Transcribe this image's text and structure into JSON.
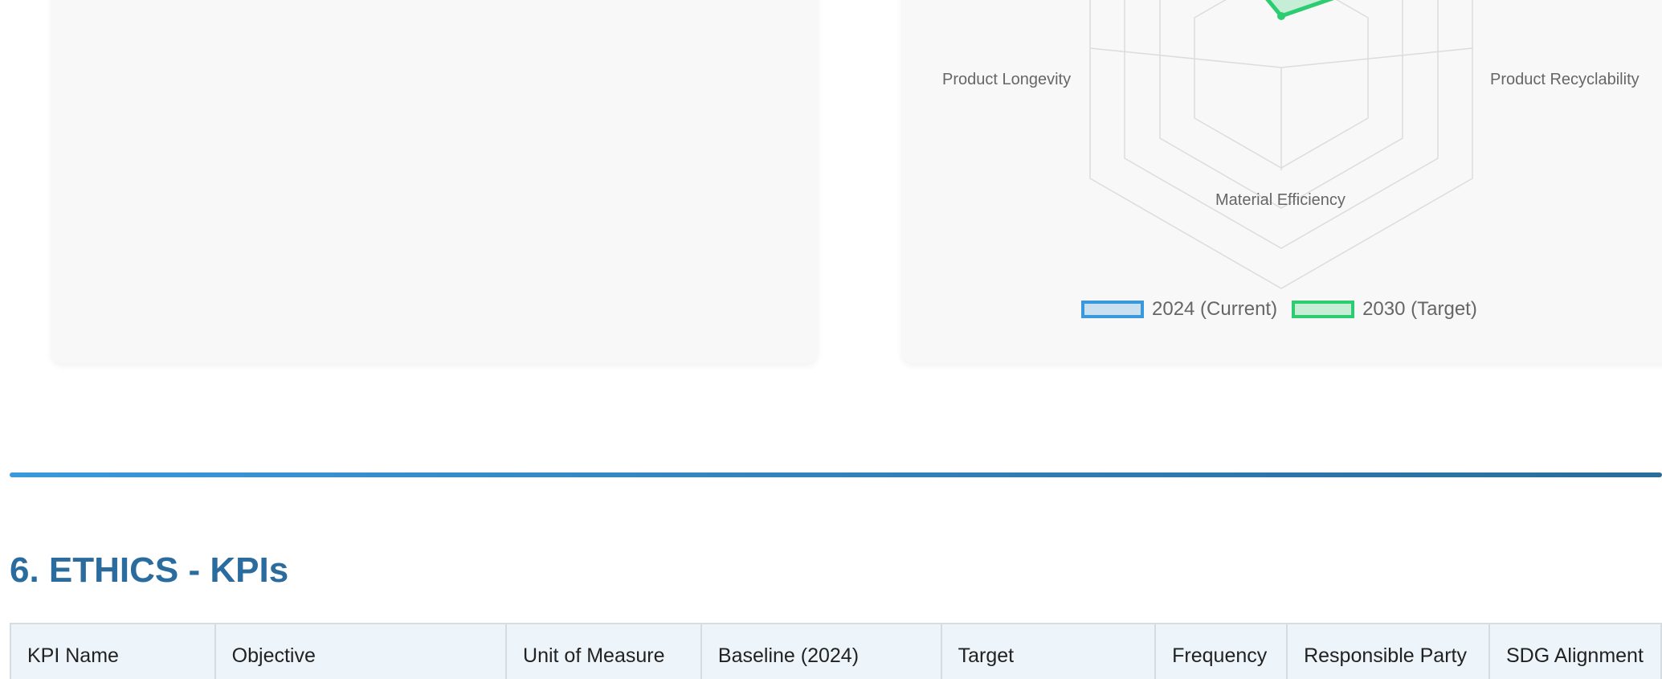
{
  "radar_chart": {
    "axis_labels": {
      "left": "Product Longevity",
      "right": "Product Recyclability",
      "bottom": "Material Efficiency"
    },
    "legend": [
      {
        "label": "2024 (Current)",
        "color": "#3a98dc"
      },
      {
        "label": "2030 (Target)",
        "color": "#2ecc71"
      }
    ]
  },
  "section": {
    "title": "6. ETHICS - KPIs"
  },
  "kpi_table": {
    "headers": [
      "KPI Name",
      "Objective",
      "Unit of Measure",
      "Baseline (2024)",
      "Target",
      "Frequency",
      "Responsible Party",
      "SDG Alignment"
    ]
  }
}
